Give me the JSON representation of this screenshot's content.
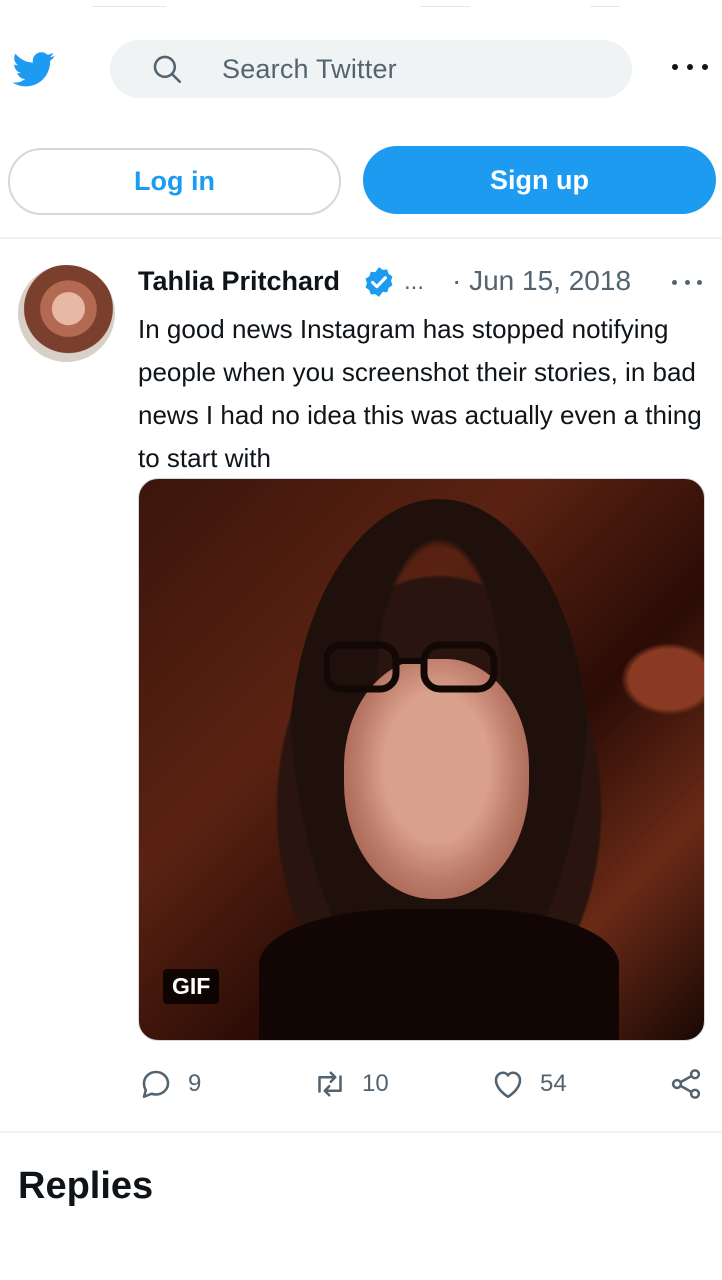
{
  "header": {
    "search_placeholder": "Search Twitter",
    "icons": [
      "twitter-bird-icon",
      "search-icon",
      "more-horizontal-icon"
    ]
  },
  "auth": {
    "login_label": "Log in",
    "signup_label": "Sign up"
  },
  "tweet": {
    "author": "Tahlia Pritchard",
    "handle_truncated": "...",
    "date": "· Jun 15, 2018",
    "text": "In good news Instagram has stopped notifying people when you screenshot their stories, in bad news I had no idea this was actually even a thing to start with",
    "media_badge": "GIF",
    "actions": {
      "replies": "9",
      "retweets": "10",
      "likes": "54"
    }
  },
  "section": {
    "replies_heading": "Replies"
  },
  "colors": {
    "brand": "#1d9bf0",
    "text": "#0f1419",
    "muted": "#536471",
    "border": "#cfd9de",
    "search_bg": "#eff3f4"
  }
}
